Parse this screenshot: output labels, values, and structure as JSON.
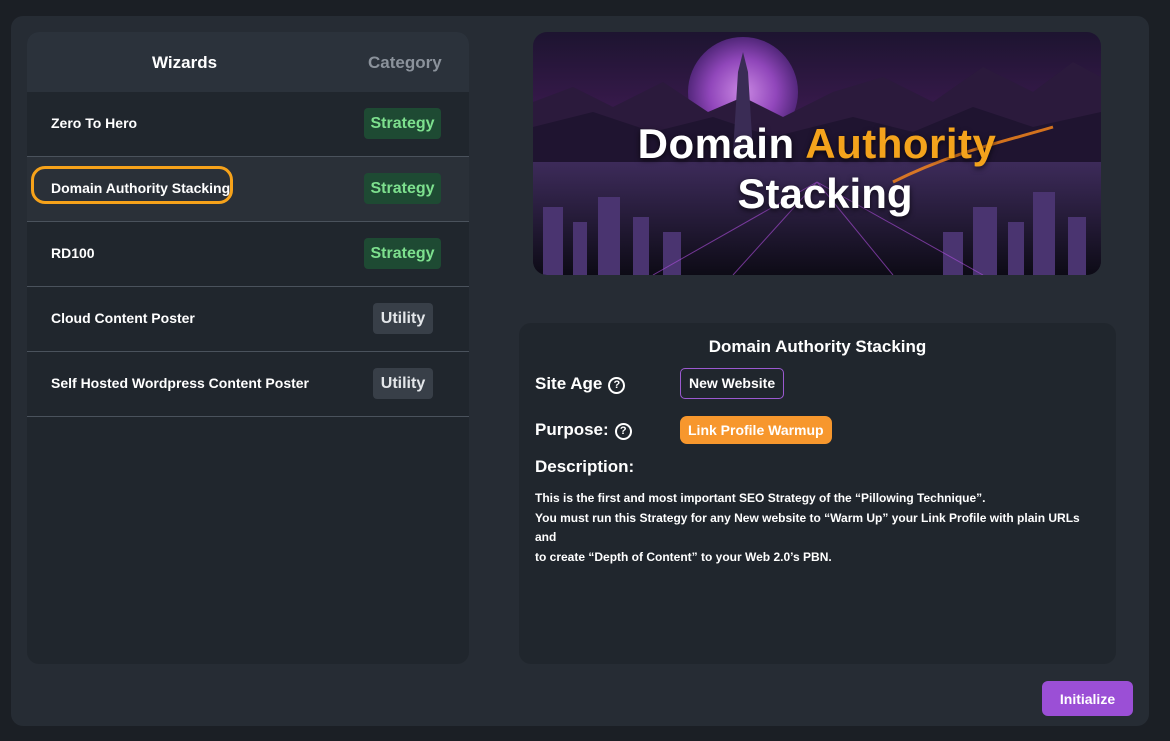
{
  "wizard_list": {
    "headers": {
      "wizards": "Wizards",
      "category": "Category"
    },
    "items": [
      {
        "name": "Zero To Hero",
        "category": "Strategy"
      },
      {
        "name": "Domain Authority Stacking",
        "category": "Strategy",
        "selected": true
      },
      {
        "name": "RD100",
        "category": "Strategy"
      },
      {
        "name": "Cloud Content Poster",
        "category": "Utility"
      },
      {
        "name": "Self Hosted Wordpress Content Poster",
        "category": "Utility"
      }
    ]
  },
  "banner": {
    "title_part1": "Domain ",
    "title_accent": "Authority",
    "title_line2": "Stacking"
  },
  "details": {
    "title": "Domain Authority Stacking",
    "site_age_label": "Site Age",
    "site_age_value": "New Website",
    "purpose_label": "Purpose:",
    "purpose_value": "Link Profile Warmup",
    "help_icon": "?",
    "description_label": "Description:",
    "description_lines": [
      "This is the first and most important SEO Strategy of the “Pillowing Technique”.",
      "You must run this Strategy for any New website to “Warm Up” your Link Profile with plain URLs and",
      "to create “Depth of Content” to your Web 2.0’s PBN."
    ]
  },
  "actions": {
    "initialize": "Initialize"
  },
  "colors": {
    "accent_orange": "#f4a31c",
    "strategy_badge_bg": "#1e4a33",
    "strategy_badge_text": "#7de08e",
    "utility_badge_bg": "#383f48",
    "purpose_pill": "#f7972d",
    "initialize_button": "#9b4fd6"
  }
}
